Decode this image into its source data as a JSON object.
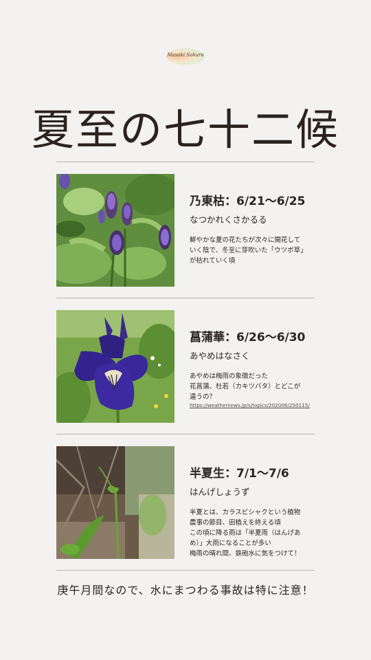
{
  "logo": {
    "text": "Masaki Sakura",
    "arc_text": ""
  },
  "title": "夏至の七十二候",
  "sections": [
    {
      "name": "乃東枯：6/21〜6/25",
      "reading": "なつかれくさかるる",
      "desc": [
        "鮮やかな夏の花たちが次々に開花して",
        "いく陰で、冬至に芽吹いた「ウツボ草」",
        "が枯れていく頃"
      ],
      "photo_icon": "self-heal-flower-photo"
    },
    {
      "name": "菖蒲華：6/26〜6/30",
      "reading": "あやめはなさく",
      "desc": [
        "あやめは梅雨の象徴だった",
        "花菖蒲、杜若（カキツバタ）とどこが",
        "違うの？"
      ],
      "link": "https://weathernews.jp/s/topics/202006/250115/",
      "photo_icon": "iris-flower-photo"
    },
    {
      "name": "半夏生：7/1〜7/6",
      "reading": "はんげしょうず",
      "desc": [
        "半夏とは、カラスビシャクという植物",
        "農事の節目、田植えを終える頃",
        "この頃に降る雨は「半夏雨（はんげあ",
        "め）」大雨になることが多い",
        "梅雨の晴れ間、鉄砲水に気をつけて！"
      ],
      "photo_icon": "crow-dipper-plant-photo"
    }
  ],
  "footer": "庚午月間なので、水にまつわる事故は特に注意！",
  "colors": {
    "background": "#f3f2f0",
    "text": "#2a2523",
    "rule": "#b8b4b0"
  }
}
